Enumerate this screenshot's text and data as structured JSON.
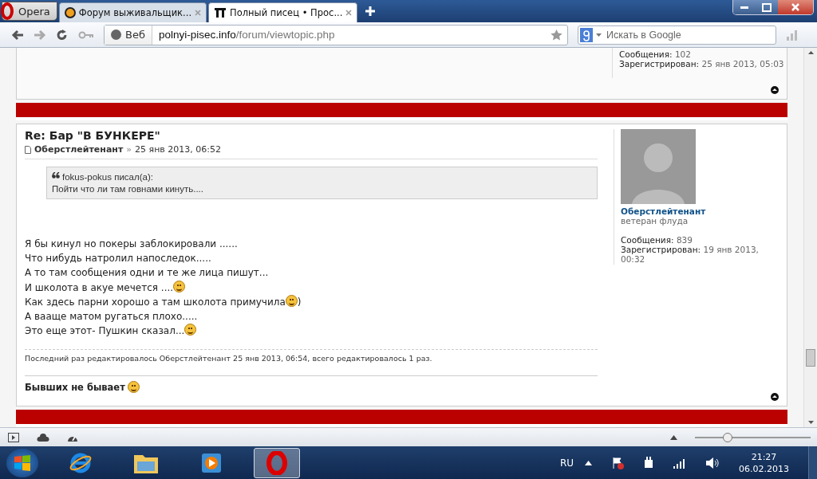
{
  "browser": {
    "menu_button": "Opera",
    "tabs": [
      {
        "title": "Форум выживальщик...",
        "selected": false
      },
      {
        "title": "Полный писец • Прос...",
        "selected": true
      }
    ],
    "address": {
      "label": "Веб",
      "host": "polnyi-pisec.info",
      "path": "/forum/viewtopic.php"
    },
    "search": {
      "placeholder": "Искать в Google"
    }
  },
  "previous_post": {
    "stats": [
      {
        "label": "Сообщения:",
        "value": "102"
      },
      {
        "label": "Зарегистрирован:",
        "value": "25 янв 2013, 05:03"
      }
    ]
  },
  "post": {
    "title": "Re: Бар \"В БУНКЕРЕ\"",
    "author": "Оберстлейтенант",
    "separator": "»",
    "date": "25 янв 2013, 06:52",
    "quote": {
      "author": "fokus-pokus писал(а):",
      "text": "Пойти что ли там говнами кинуть...."
    },
    "lines": [
      [
        {
          "kind": "text",
          "text": "Я бы кинул но покеры заблокировали ......"
        }
      ],
      [
        {
          "kind": "text",
          "text": "Что нибудь натролил напоследок....."
        }
      ],
      [
        {
          "kind": "text",
          "text": "А то там сообщения одни и те же лица пишут..."
        }
      ],
      [
        {
          "kind": "text",
          "text": "И школота в акуе мечется ...."
        },
        {
          "kind": "smiley"
        }
      ],
      [
        {
          "kind": "text",
          "text": "Как здесь парни хорошо а там школота примучила "
        },
        {
          "kind": "smiley"
        },
        {
          "kind": "text",
          "text": ")"
        }
      ],
      [
        {
          "kind": "text",
          "text": "А вааще матом ругаться плохо....."
        }
      ],
      [
        {
          "kind": "text",
          "text": "Это еще этот- Пушкин сказал..."
        },
        {
          "kind": "smiley"
        }
      ]
    ],
    "edit_note": "Последний раз редактировалось Оберстлейтенант 25 янв 2013, 06:54, всего редактировалось 1 раз.",
    "signature": "Бывших не бывает",
    "profile": {
      "name": "Оберстлейтенант",
      "rank": "ветеран флуда",
      "stats": [
        {
          "label": "Сообщения:",
          "value": "839"
        },
        {
          "label": "Зарегистрирован:",
          "value": "19 янв 2013, 00:32"
        }
      ]
    }
  },
  "status_bar": {
    "zoom_slider": {
      "level": 0.28
    }
  },
  "taskbar": {
    "apps": [
      {
        "kind": "ie",
        "selected": false
      },
      {
        "kind": "explorer",
        "selected": false
      },
      {
        "kind": "media",
        "selected": false
      },
      {
        "kind": "opera",
        "selected": true
      }
    ],
    "language": "RU",
    "time": "21:27",
    "date": "06.02.2013"
  }
}
